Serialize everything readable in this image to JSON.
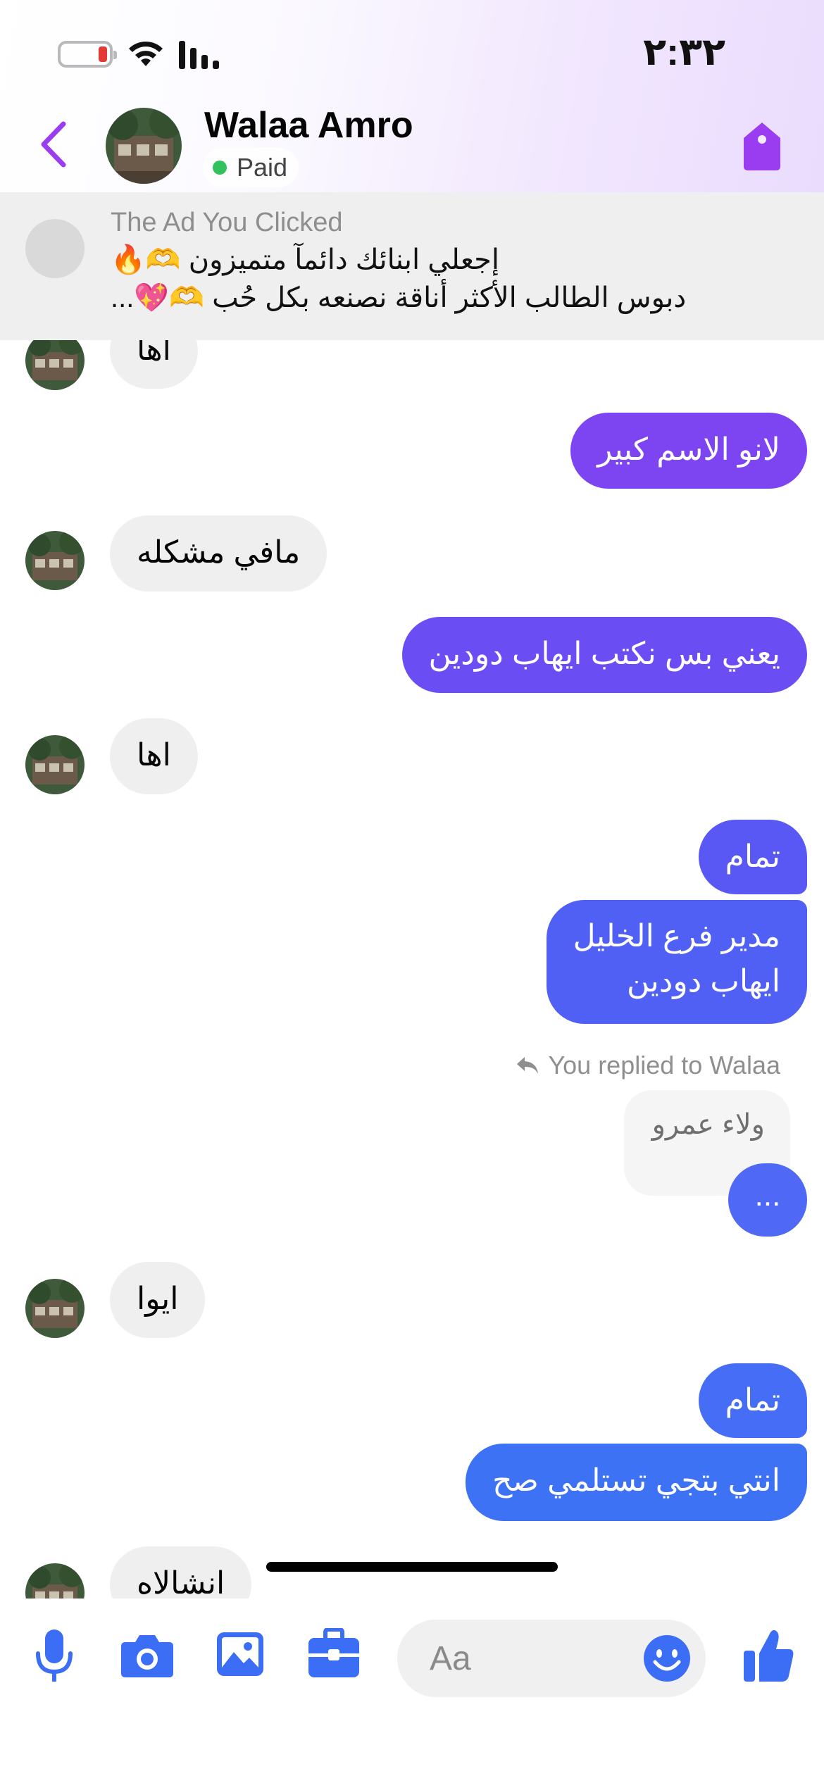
{
  "status_bar": {
    "time": "٢:٣٢"
  },
  "header": {
    "name": "Walaa Amro",
    "badge": "Paid",
    "accent_color": "#9a3cf0"
  },
  "ad": {
    "title": "The Ad You Clicked",
    "line1": "إجعلي ابنائك دائمآ متميزون 🫶🔥",
    "line2": "دبوس الطالب الأكثر أناقة نصنعه بكل حُب 🫶💖..."
  },
  "messages": {
    "m1": "اها",
    "m2": "لانو الاسم كبير",
    "m3": "مافي مشكله",
    "m4": "يعني بس نكتب ايهاب دودين",
    "m5": "اها",
    "m6": "تمام",
    "m7_line1": "مدير فرع الخليل",
    "m7_line2": "ايهاب دودين",
    "reply_label": "You replied to Walaa",
    "quoted": "ولاء عمرو",
    "m8": "...",
    "m9": "ايوا",
    "m10": "تمام",
    "m11": "انتي بتجي تستلمي صح",
    "m12": "انشالاه"
  },
  "composer": {
    "placeholder": "Aa",
    "icon_color": "#3b6ef5"
  },
  "colors": {
    "bubble_incoming": "#efefef",
    "outgoing_gradient_top": "#8b3cf0",
    "outgoing_gradient_bottom": "#3c74f4"
  }
}
